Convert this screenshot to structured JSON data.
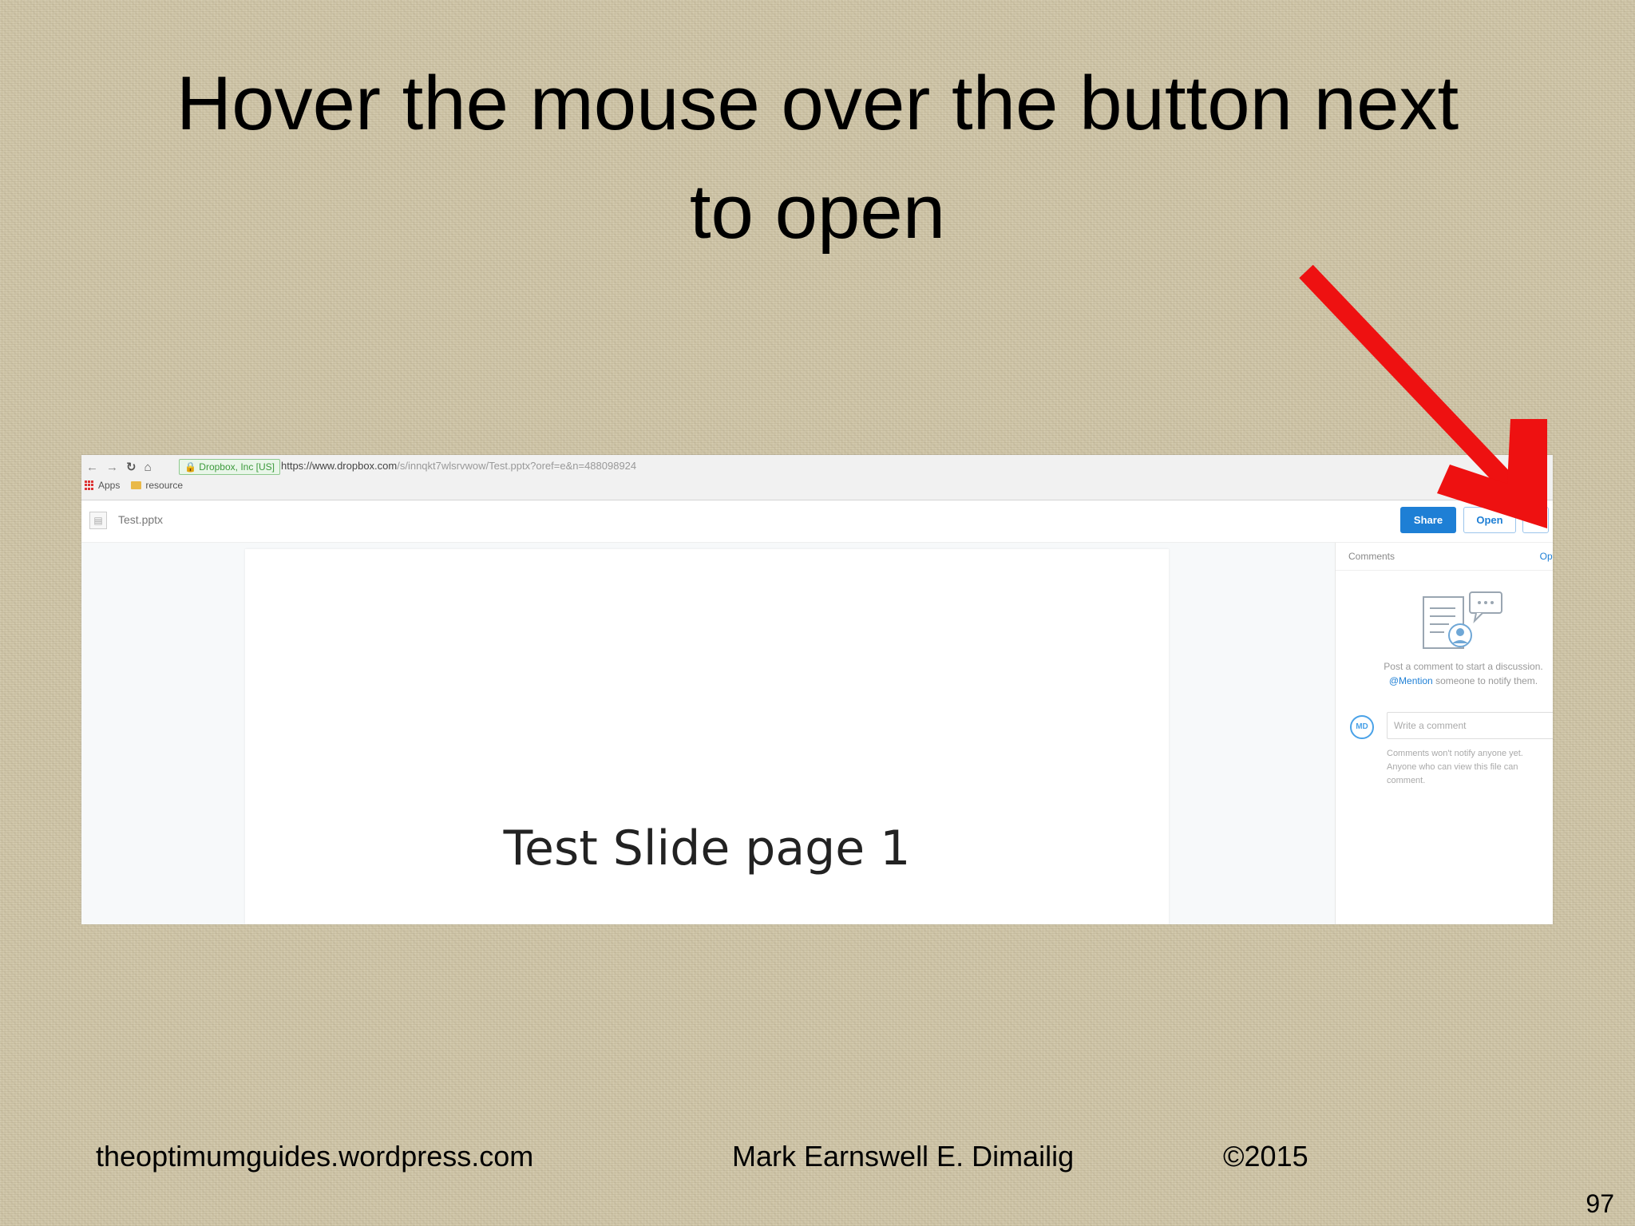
{
  "slide": {
    "title_line1": "Hover the mouse over the button next",
    "title_line2": "to open",
    "footer_site": "theoptimumguides.wordpress.com",
    "footer_author": "Mark Earnswell E. Dimailig",
    "footer_copyright": "©2015",
    "page_number": "97",
    "arrow_color": "#ee1111"
  },
  "browser": {
    "ev_badge": "Dropbox, Inc [US]",
    "url_host": "https://www.dropbox.com",
    "url_path": "/s/innqkt7wlsrvwow/Test.pptx?oref=e&n=488098924",
    "bookmarks": [
      "Apps",
      "resource"
    ]
  },
  "dropbox": {
    "file_name": "Test.pptx",
    "share_label": "Share",
    "open_label": "Open",
    "accent_color": "#1e7fd5",
    "preview_text": "Test Slide page 1"
  },
  "comments": {
    "header": "Comments",
    "options_label": "Opt",
    "empty_line1": "Post a comment to start a discussion.",
    "mention": "@Mention",
    "empty_line2_rest": " someone to notify them.",
    "avatar_initials": "MD",
    "input_placeholder": "Write a comment",
    "note": "Comments won't notify anyone yet. Anyone who can view this file can comment."
  }
}
